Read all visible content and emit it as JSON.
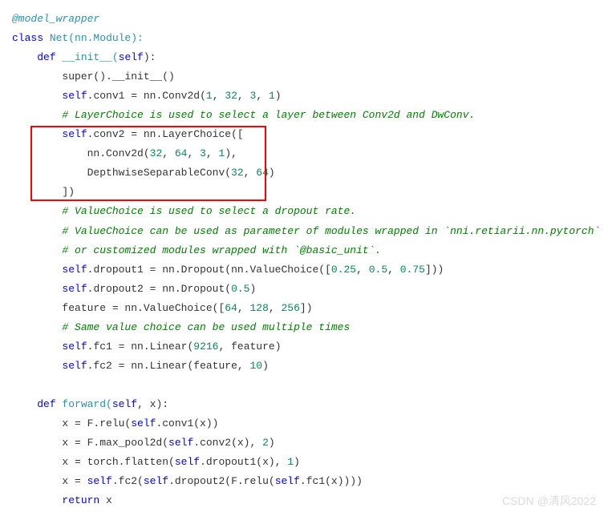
{
  "code": {
    "l01": "@model_wrapper",
    "l02a": "class",
    "l02b": " Net(nn.Module):",
    "l03a": "    ",
    "l03b": "def",
    "l03c": " __init__(",
    "l03d": "self",
    "l03e": "):",
    "l04a": "        super().__init__()",
    "l05a": "        ",
    "l05b": "self",
    "l05c": ".conv1 = nn.Conv2d(",
    "l05d": "1",
    "l05e": ", ",
    "l05f": "32",
    "l05g": ", ",
    "l05h": "3",
    "l05i": ", ",
    "l05j": "1",
    "l05k": ")",
    "l06a": "        ",
    "l06b": "# LayerChoice is used to select a layer between Conv2d and DwConv.",
    "l07a": "        ",
    "l07b": "self",
    "l07c": ".conv2 = nn.LayerChoice([",
    "l08a": "            nn.Conv2d(",
    "l08b": "32",
    "l08c": ", ",
    "l08d": "64",
    "l08e": ", ",
    "l08f": "3",
    "l08g": ", ",
    "l08h": "1",
    "l08i": "),",
    "l09a": "            DepthwiseSeparableConv(",
    "l09b": "32",
    "l09c": ", ",
    "l09d": "64",
    "l09e": ")",
    "l10a": "        ])",
    "l11a": "        ",
    "l11b": "# ValueChoice is used to select a dropout rate.",
    "l12a": "        ",
    "l12b": "# ValueChoice can be used as parameter of modules wrapped in `nni.retiarii.nn.pytorch`",
    "l13a": "        ",
    "l13b": "# or customized modules wrapped with `@basic_unit`.",
    "l14a": "        ",
    "l14b": "self",
    "l14c": ".dropout1 = nn.Dropout(nn.ValueChoice([",
    "l14d": "0.25",
    "l14e": ", ",
    "l14f": "0.5",
    "l14g": ", ",
    "l14h": "0.75",
    "l14i": "]))",
    "l15a": "        ",
    "l15b": "self",
    "l15c": ".dropout2 = nn.Dropout(",
    "l15d": "0.5",
    "l15e": ")",
    "l16a": "        feature = nn.ValueChoice([",
    "l16b": "64",
    "l16c": ", ",
    "l16d": "128",
    "l16e": ", ",
    "l16f": "256",
    "l16g": "])",
    "l17a": "        ",
    "l17b": "# Same value choice can be used multiple times",
    "l18a": "        ",
    "l18b": "self",
    "l18c": ".fc1 = nn.Linear(",
    "l18d": "9216",
    "l18e": ", feature)",
    "l19a": "        ",
    "l19b": "self",
    "l19c": ".fc2 = nn.Linear(feature, ",
    "l19d": "10",
    "l19e": ")",
    "l20": " ",
    "l21a": "    ",
    "l21b": "def",
    "l21c": " forward(",
    "l21d": "self",
    "l21e": ", x):",
    "l22a": "        x = F.relu(",
    "l22b": "self",
    "l22c": ".conv1(x))",
    "l23a": "        x = F.max_pool2d(",
    "l23b": "self",
    "l23c": ".conv2(x), ",
    "l23d": "2",
    "l23e": ")",
    "l24a": "        x = torch.flatten(",
    "l24b": "self",
    "l24c": ".dropout1(x), ",
    "l24d": "1",
    "l24e": ")",
    "l25a": "        x = ",
    "l25b": "self",
    "l25c": ".fc2(",
    "l25d": "self",
    "l25e": ".dropout2(F.relu(",
    "l25f": "self",
    "l25g": ".fc1(x))))",
    "l26a": "        ",
    "l26b": "return",
    "l26c": " x"
  },
  "watermark": "CSDN @清风2022"
}
